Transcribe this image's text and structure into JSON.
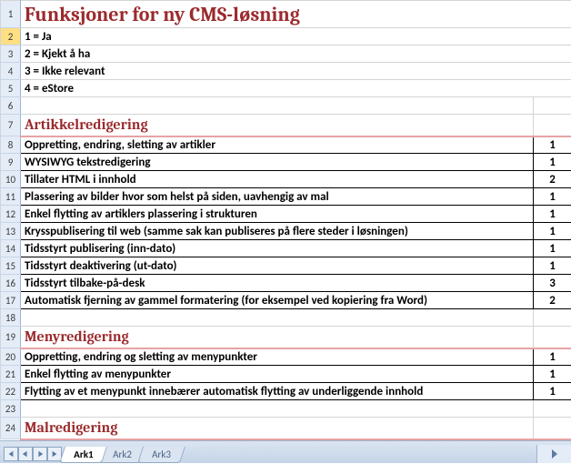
{
  "title": "Funksjoner for ny CMS-løsning",
  "legend": {
    "r2": "1 = Ja",
    "r3": "2 = Kjekt å ha",
    "r4": "3 = Ikke relevant",
    "r5": "4 = eStore"
  },
  "sections": {
    "s1": "Artikkelredigering",
    "s2": "Menyredigering",
    "s3": "Malredigering"
  },
  "rows": {
    "r8": {
      "text": "Oppretting, endring, sletting av artikler",
      "val": "1"
    },
    "r9": {
      "text": "WYSIWYG tekstredigering",
      "val": "1"
    },
    "r10": {
      "text": "Tillater HTML i innhold",
      "val": "2"
    },
    "r11": {
      "text": "Plassering av bilder hvor som helst på siden, uavhengig av mal",
      "val": "1"
    },
    "r12": {
      "text": "Enkel flytting av artiklers plassering i strukturen",
      "val": "1"
    },
    "r13": {
      "text": "Krysspublisering til web (samme sak kan publiseres på flere steder i løsningen)",
      "val": "1"
    },
    "r14": {
      "text": "Tidsstyrt publisering (inn-dato)",
      "val": "1"
    },
    "r15": {
      "text": "Tidsstyrt deaktivering (ut-dato)",
      "val": "1"
    },
    "r16": {
      "text": "Tidsstyrt tilbake-på-desk",
      "val": "3"
    },
    "r17": {
      "text": "Automatisk fjerning av gammel formatering (for eksempel ved kopiering fra Word)",
      "val": "2"
    },
    "r20": {
      "text": "Oppretting, endring og sletting av menypunkter",
      "val": "1"
    },
    "r21": {
      "text": "Enkel flytting av menypunkter",
      "val": "1"
    },
    "r22": {
      "text": "Flytting av et menypunkt innebærer automatisk flytting av underliggende innhold",
      "val": "1"
    }
  },
  "rownums": {
    "r1": "1",
    "r2": "2",
    "r3": "3",
    "r4": "4",
    "r5": "5",
    "r6": "6",
    "r7": "7",
    "r8": "8",
    "r9": "9",
    "r10": "10",
    "r11": "11",
    "r12": "12",
    "r13": "13",
    "r14": "14",
    "r15": "15",
    "r16": "16",
    "r17": "17",
    "r18": "18",
    "r19": "19",
    "r20": "20",
    "r21": "21",
    "r22": "22",
    "r23": "23",
    "r24": "24"
  },
  "tabs": {
    "t1": "Ark1",
    "t2": "Ark2",
    "t3": "Ark3"
  }
}
